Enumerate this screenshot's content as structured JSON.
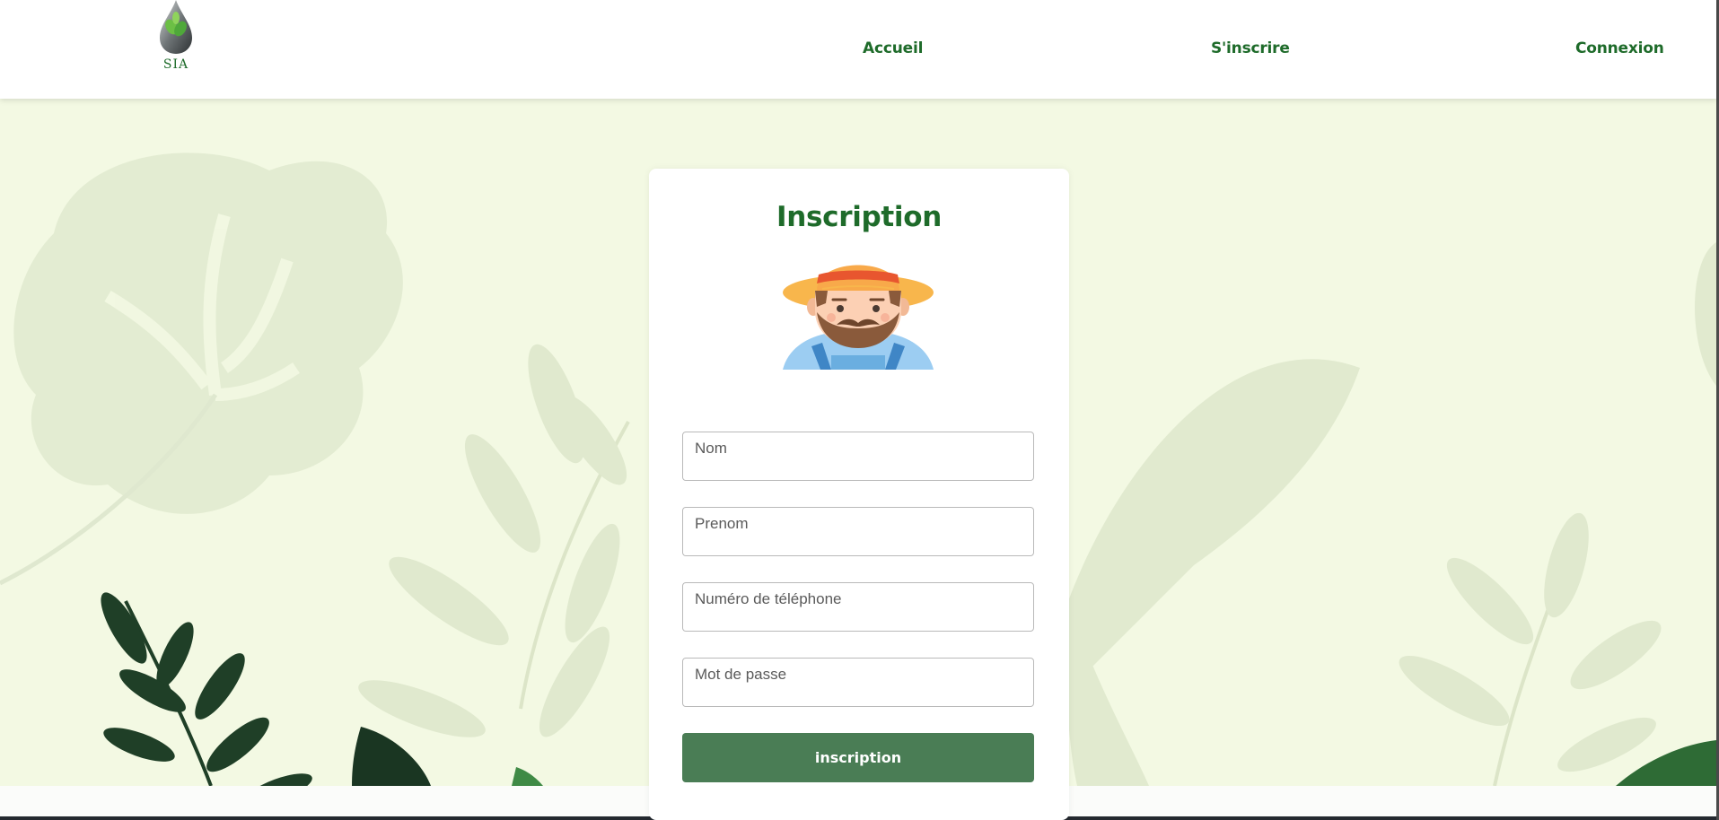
{
  "header": {
    "logo_text": "SIA",
    "nav": {
      "home": "Accueil",
      "register": "S'inscrire",
      "login": "Connexion"
    }
  },
  "form": {
    "title": "Inscription",
    "fields": {
      "nom": {
        "placeholder": "Nom",
        "value": ""
      },
      "prenom": {
        "placeholder": "Prenom",
        "value": ""
      },
      "telephone": {
        "placeholder": "Numéro de téléphone",
        "value": ""
      },
      "password": {
        "placeholder": "Mot de passe",
        "value": ""
      }
    },
    "submit_label": "inscription"
  },
  "colors": {
    "brand_green": "#1e6b2a",
    "button_green": "#4a7d55",
    "background": "#f3f9e3"
  },
  "icons": [
    "logo-drop-icon",
    "farmer-avatar-icon"
  ]
}
